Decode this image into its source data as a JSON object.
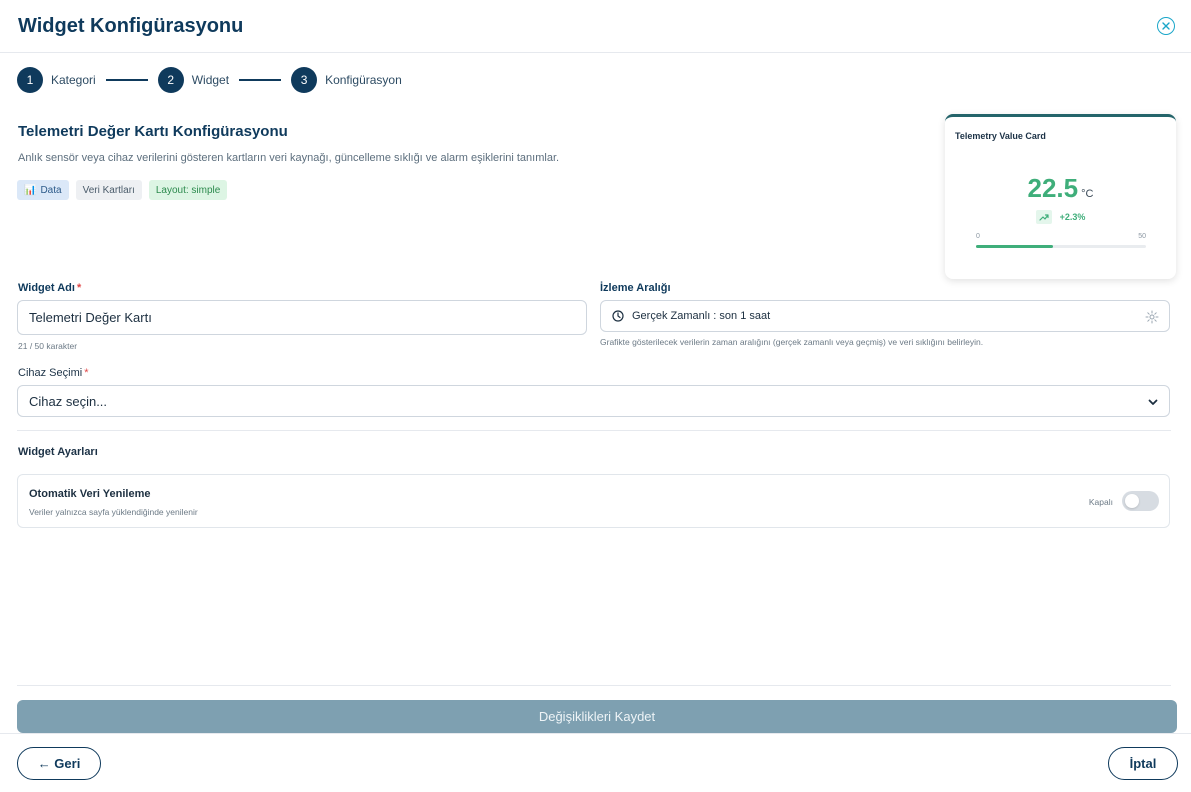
{
  "modal": {
    "title": "Widget Konfigürasyonu"
  },
  "stepper": {
    "steps": [
      {
        "number": "1",
        "label": "Kategori"
      },
      {
        "number": "2",
        "label": "Widget"
      },
      {
        "number": "3",
        "label": "Konfigürasyon"
      }
    ]
  },
  "widget_info": {
    "title": "Telemetri Değer Kartı Konfigürasyonu",
    "description": "Anlık sensör veya cihaz verilerini gösteren kartların veri kaynağı, güncelleme sıklığı ve alarm eşiklerini tanımlar.",
    "tags": {
      "data": "Data",
      "category": "Veri Kartları",
      "layout": "Layout: simple"
    }
  },
  "preview": {
    "title": "Telemetry Value Card",
    "value": "22.5",
    "unit": "°C",
    "trend": "+2.3%",
    "min": "0",
    "max": "50",
    "progress_fraction": 0.45
  },
  "form": {
    "name_label": "Widget Adı",
    "required_mark": "*",
    "name_value": "Telemetri Değer Kartı",
    "name_counter": "21 / 50 karakter",
    "interval_label": "İzleme Aralığı",
    "interval_value": "Gerçek Zamanlı : son 1 saat",
    "interval_help": "Grafikte gösterilecek verilerin zaman aralığını (gerçek zamanlı veya geçmiş) ve veri sıklığını belirleyin.",
    "device_label": "Cihaz Seçimi",
    "device_placeholder": "Cihaz seçin..."
  },
  "settings": {
    "title": "Widget Ayarları",
    "auto_refresh": {
      "name": "Otomatik Veri Yenileme",
      "description": "Veriler yalnızca sayfa yüklendiğinde yenilenir",
      "state_label": "Kapalı",
      "enabled": false
    }
  },
  "actions": {
    "save": "Değişiklikleri Kaydet",
    "back": "← Geri",
    "cancel": "İptal"
  },
  "colors": {
    "primary": "#0f3a5c",
    "accent": "#3fae7a",
    "close": "#1aa6c9",
    "save_disabled": "#7ea0b1"
  }
}
